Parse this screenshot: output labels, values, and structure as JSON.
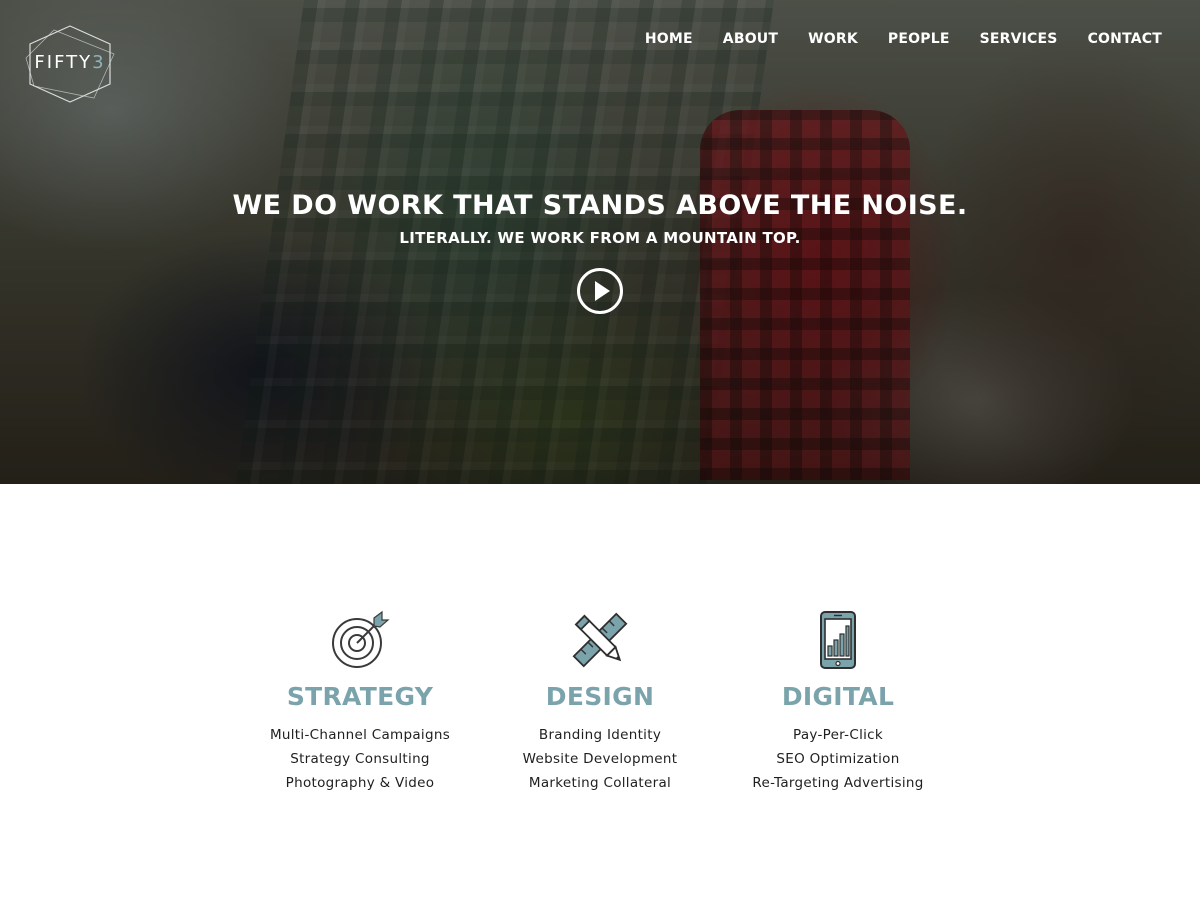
{
  "brand": {
    "logo_text": "FIFTY",
    "logo_number": "3",
    "accent_color": "#7aa3ab"
  },
  "nav": {
    "items": [
      {
        "label": "HOME"
      },
      {
        "label": "ABOUT"
      },
      {
        "label": "WORK"
      },
      {
        "label": "PEOPLE"
      },
      {
        "label": "SERVICES"
      },
      {
        "label": "CONTACT"
      }
    ]
  },
  "hero": {
    "headline": "WE DO WORK THAT STANDS ABOVE THE NOISE.",
    "subline": "LITERALLY. WE WORK FROM A MOUNTAIN TOP.",
    "play_icon": "play-circle-icon"
  },
  "services": [
    {
      "icon": "target-icon",
      "title": "STRATEGY",
      "items": [
        "Multi-Channel Campaigns",
        "Strategy Consulting",
        "Photography & Video"
      ]
    },
    {
      "icon": "pencil-ruler-icon",
      "title": "DESIGN",
      "items": [
        "Branding Identity",
        "Website Development",
        "Marketing Collateral"
      ]
    },
    {
      "icon": "mobile-chart-icon",
      "title": "DIGITAL",
      "items": [
        "Pay-Per-Click",
        "SEO Optimization",
        "Re-Targeting Advertising"
      ]
    }
  ]
}
